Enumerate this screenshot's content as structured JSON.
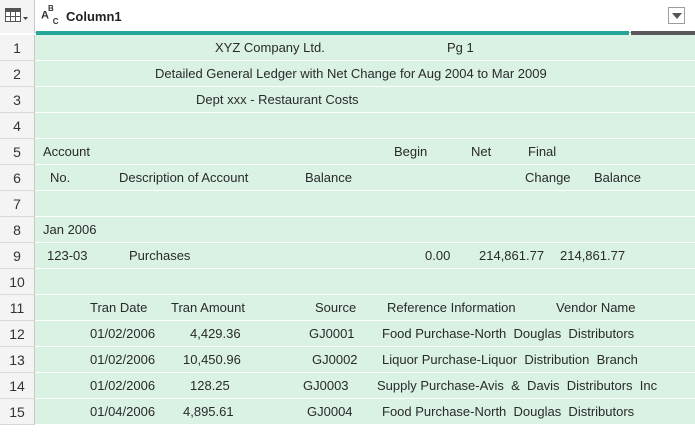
{
  "header": {
    "column_title": "Column1",
    "type_icon": "abc-text-type-icon",
    "table_icon": "table-icon",
    "dropdown_icon": "chevron-down-icon",
    "valid_fraction": 0.9,
    "quality_colors": {
      "valid": "#26a69a",
      "empty": "#595959"
    }
  },
  "row_numbers": [
    "1",
    "2",
    "3",
    "4",
    "5",
    "6",
    "7",
    "8",
    "9",
    "10",
    "11",
    "12",
    "13",
    "14",
    "15"
  ],
  "rows": [
    {
      "cells": [
        {
          "text": "XYZ Company Ltd."
        },
        {
          "text": "Pg 1"
        }
      ]
    },
    {
      "cells": [
        {
          "text": "Detailed General Ledger with Net Change for Aug 2004 to Mar 2009"
        }
      ]
    },
    {
      "cells": [
        {
          "text": "Dept xxx - Restaurant Costs"
        }
      ]
    },
    {
      "cells": []
    },
    {
      "cells": [
        {
          "text": "Account"
        },
        {
          "text": "Begin"
        },
        {
          "text": "Net"
        },
        {
          "text": "Final"
        }
      ]
    },
    {
      "cells": [
        {
          "text": "No."
        },
        {
          "text": "Description of Account"
        },
        {
          "text": "Balance"
        },
        {
          "text": "Change"
        },
        {
          "text": "Balance"
        }
      ]
    },
    {
      "cells": []
    },
    {
      "cells": [
        {
          "text": "Jan 2006"
        }
      ]
    },
    {
      "cells": [
        {
          "text": "123-03"
        },
        {
          "text": "Purchases"
        },
        {
          "text": "0.00"
        },
        {
          "text": "214,861.77"
        },
        {
          "text": "214,861.77"
        }
      ]
    },
    {
      "cells": []
    },
    {
      "cells": [
        {
          "text": "Tran Date"
        },
        {
          "text": "Tran Amount"
        },
        {
          "text": "Source"
        },
        {
          "text": "Reference Information"
        },
        {
          "text": "Vendor Name"
        }
      ]
    },
    {
      "cells": [
        {
          "text": "01/02/2006"
        },
        {
          "text": "4,429.36"
        },
        {
          "text": "GJ0001"
        },
        {
          "text": "Food Purchase-North  Douglas  Distributors"
        }
      ]
    },
    {
      "cells": [
        {
          "text": "01/02/2006"
        },
        {
          "text": "10,450.96"
        },
        {
          "text": "GJ0002"
        },
        {
          "text": "Liquor Purchase-Liquor  Distribution  Branch"
        }
      ]
    },
    {
      "cells": [
        {
          "text": "01/02/2006"
        },
        {
          "text": "128.25"
        },
        {
          "text": "GJ0003"
        },
        {
          "text": "Supply Purchase-Avis  &  Davis  Distributors  Inc"
        }
      ]
    },
    {
      "cells": [
        {
          "text": "01/04/2006"
        },
        {
          "text": "4,895.61"
        },
        {
          "text": "GJ0004"
        },
        {
          "text": "Food Purchase-North  Douglas  Distributors"
        }
      ]
    }
  ]
}
